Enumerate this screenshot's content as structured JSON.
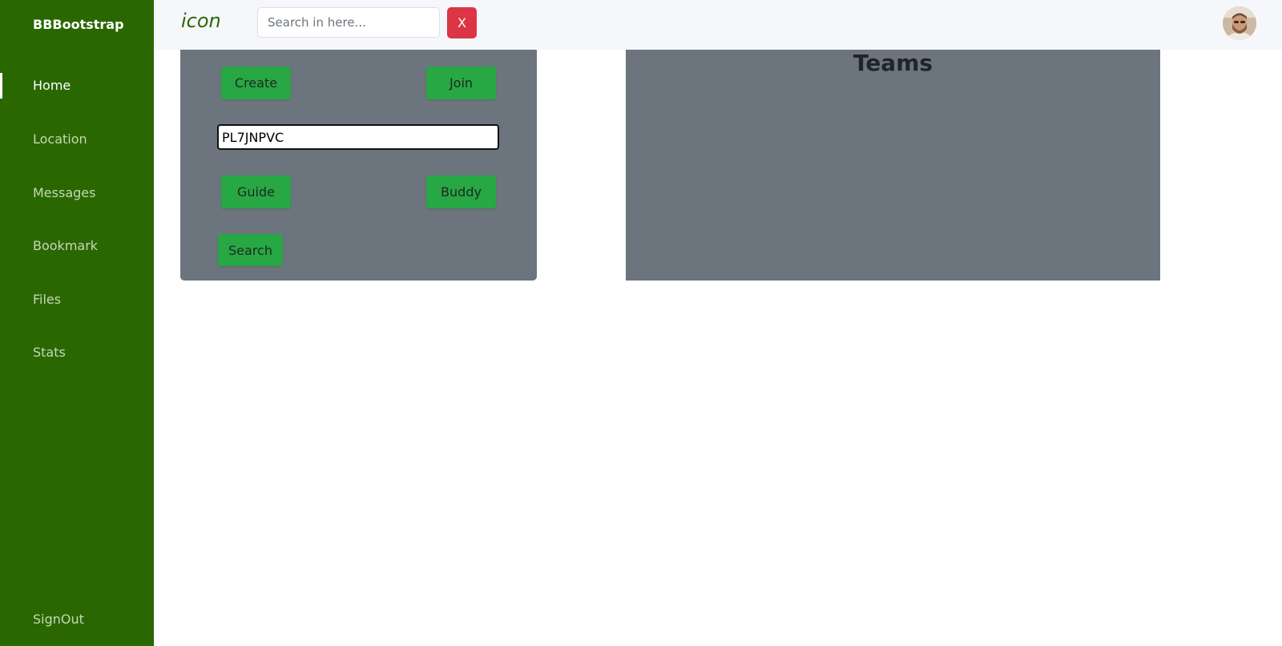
{
  "sidebar": {
    "brand": "BBBootstrap",
    "items": [
      {
        "label": "Home",
        "active": true
      },
      {
        "label": "Location",
        "active": false
      },
      {
        "label": "Messages",
        "active": false
      },
      {
        "label": "Bookmark",
        "active": false
      },
      {
        "label": "Files",
        "active": false
      },
      {
        "label": "Stats",
        "active": false
      }
    ],
    "signout": "SignOut"
  },
  "topbar": {
    "logo_text": "icon",
    "search_placeholder": "Search in here...",
    "clear_label": "X"
  },
  "team_panel": {
    "create_label": "Create",
    "join_label": "Join",
    "code_value": "PL7JNPVC",
    "guide_label": "Guide",
    "buddy_label": "Buddy",
    "search_label": "Search"
  },
  "teams_panel": {
    "title": "Teams"
  },
  "colors": {
    "sidebar": "#2a6700",
    "panel": "#6c757d",
    "button_green": "#28a745",
    "button_red": "#dc3545"
  }
}
